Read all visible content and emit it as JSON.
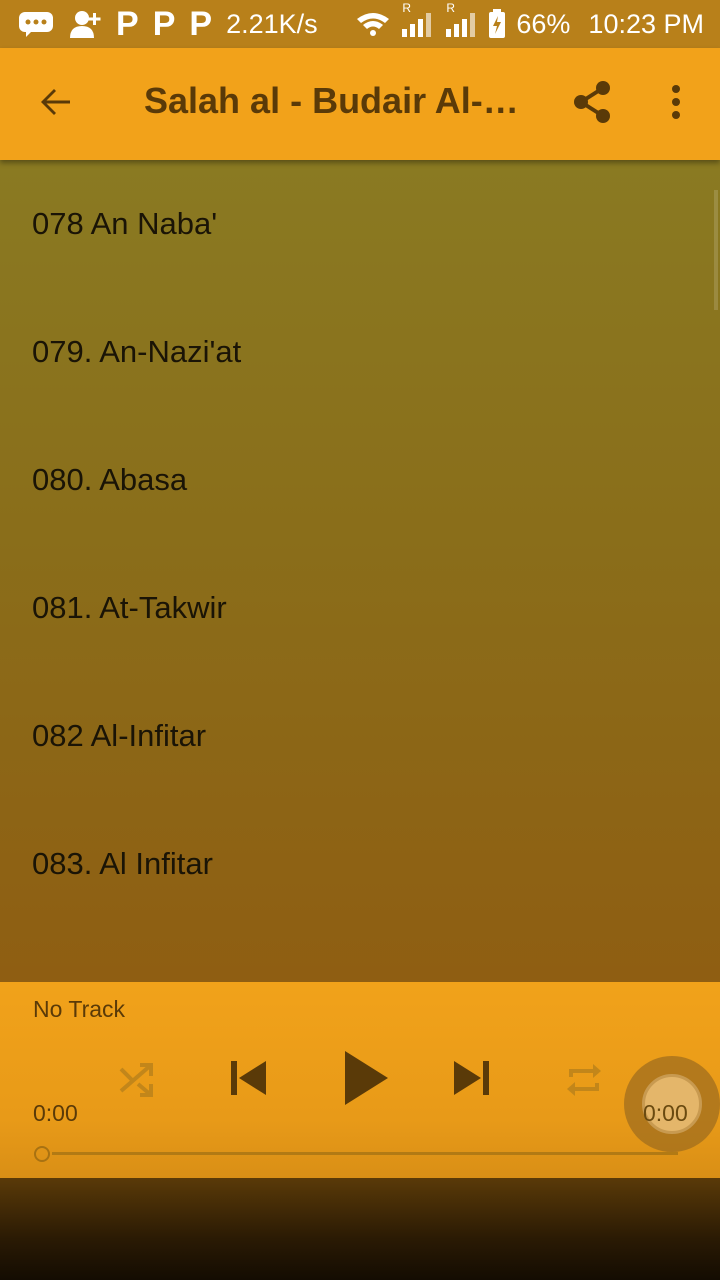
{
  "status_bar": {
    "net_speed": "2.21K/s",
    "battery": "66%",
    "time": "10:23 PM",
    "signal_marker_1": "R",
    "signal_marker_2": "R",
    "p_badge": "P"
  },
  "app_bar": {
    "title": "Salah al - Budair Al-…"
  },
  "tracks": [
    "078 An Naba'",
    "079. An-Nazi'at",
    "080. Abasa",
    "081. At-Takwir",
    "082 Al-Infitar",
    "083. Al Infitar"
  ],
  "player": {
    "now_playing": "No Track",
    "time_start": "0:00",
    "time_end": "0:00",
    "progress": 0
  },
  "colors": {
    "accent": "#f2a21a",
    "icon_dark": "#5a3a08"
  }
}
